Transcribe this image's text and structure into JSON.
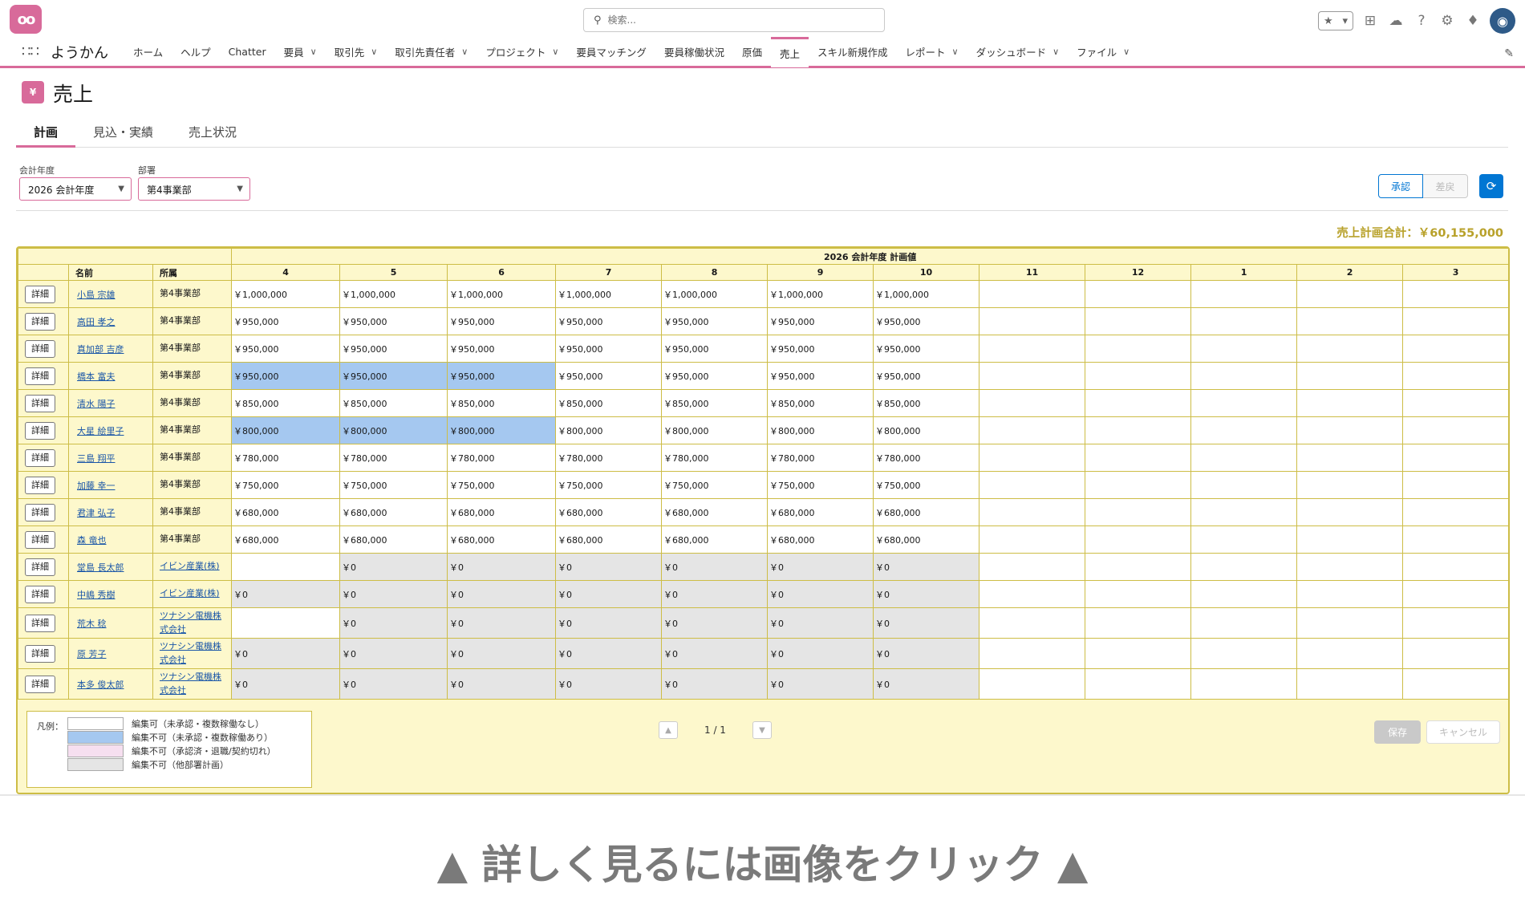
{
  "topbar": {
    "search_placeholder": "検索...",
    "icons": [
      "favorites-star-icon",
      "add-icon",
      "trailhead-icon",
      "help-icon",
      "gear-icon",
      "bell-icon",
      "avatar"
    ]
  },
  "nav": {
    "app_name": "ようかん",
    "items": [
      {
        "label": "ホーム",
        "chevron": false
      },
      {
        "label": "ヘルプ",
        "chevron": false
      },
      {
        "label": "Chatter",
        "chevron": false
      },
      {
        "label": "要員",
        "chevron": true
      },
      {
        "label": "取引先",
        "chevron": true
      },
      {
        "label": "取引先責任者",
        "chevron": true
      },
      {
        "label": "プロジェクト",
        "chevron": true
      },
      {
        "label": "要員マッチング",
        "chevron": false
      },
      {
        "label": "要員稼働状況",
        "chevron": false
      },
      {
        "label": "原価",
        "chevron": false
      },
      {
        "label": "売上",
        "chevron": false,
        "active": true
      },
      {
        "label": "スキル新規作成",
        "chevron": false
      },
      {
        "label": "レポート",
        "chevron": true
      },
      {
        "label": "ダッシュボード",
        "chevron": true
      },
      {
        "label": "ファイル",
        "chevron": true
      }
    ]
  },
  "page": {
    "icon_text": "¥",
    "title": "売上",
    "tabs": [
      "計画",
      "見込・実績",
      "売上状況"
    ]
  },
  "filters": {
    "year_label": "会計年度",
    "year_value": "2026 会計年度",
    "dept_label": "部署",
    "dept_value": "第4事業部"
  },
  "actions": {
    "approve": "承認",
    "revert": "差戻",
    "refresh_icon": "refresh-icon"
  },
  "total_text": "売上計画合計：￥60,155,000",
  "table": {
    "header_title": "2026 会計年度 計画値",
    "col_name": "名前",
    "col_aff": "所属",
    "months": [
      "4",
      "5",
      "6",
      "7",
      "8",
      "9",
      "10",
      "11",
      "12",
      "1",
      "2",
      "3"
    ],
    "detail_label": "詳細",
    "rows": [
      {
        "name": "小島 宗雄",
        "aff": "第4事業部",
        "aff_link": false,
        "tall": false,
        "cells": [
          [
            "w",
            "￥1,000,000"
          ],
          [
            "w",
            "￥1,000,000"
          ],
          [
            "w",
            "￥1,000,000"
          ],
          [
            "w",
            "￥1,000,000"
          ],
          [
            "w",
            "￥1,000,000"
          ],
          [
            "w",
            "￥1,000,000"
          ],
          [
            "w",
            "￥1,000,000"
          ],
          [
            "w",
            ""
          ],
          [
            "w",
            ""
          ],
          [
            "w",
            ""
          ],
          [
            "w",
            ""
          ],
          [
            "w",
            ""
          ]
        ]
      },
      {
        "name": "高田 孝之",
        "aff": "第4事業部",
        "aff_link": false,
        "tall": false,
        "cells": [
          [
            "w",
            "￥950,000"
          ],
          [
            "w",
            "￥950,000"
          ],
          [
            "w",
            "￥950,000"
          ],
          [
            "w",
            "￥950,000"
          ],
          [
            "w",
            "￥950,000"
          ],
          [
            "w",
            "￥950,000"
          ],
          [
            "w",
            "￥950,000"
          ],
          [
            "w",
            ""
          ],
          [
            "w",
            ""
          ],
          [
            "w",
            ""
          ],
          [
            "w",
            ""
          ],
          [
            "w",
            ""
          ]
        ]
      },
      {
        "name": "真加部 吉彦",
        "aff": "第4事業部",
        "aff_link": false,
        "tall": false,
        "cells": [
          [
            "w",
            "￥950,000"
          ],
          [
            "w",
            "￥950,000"
          ],
          [
            "w",
            "￥950,000"
          ],
          [
            "w",
            "￥950,000"
          ],
          [
            "w",
            "￥950,000"
          ],
          [
            "w",
            "￥950,000"
          ],
          [
            "w",
            "￥950,000"
          ],
          [
            "w",
            ""
          ],
          [
            "w",
            ""
          ],
          [
            "w",
            ""
          ],
          [
            "w",
            ""
          ],
          [
            "w",
            ""
          ]
        ]
      },
      {
        "name": "橋本 富夫",
        "aff": "第4事業部",
        "aff_link": false,
        "tall": false,
        "cells": [
          [
            "b",
            "￥950,000"
          ],
          [
            "b",
            "￥950,000"
          ],
          [
            "b",
            "￥950,000"
          ],
          [
            "w",
            "￥950,000"
          ],
          [
            "w",
            "￥950,000"
          ],
          [
            "w",
            "￥950,000"
          ],
          [
            "w",
            "￥950,000"
          ],
          [
            "w",
            ""
          ],
          [
            "w",
            ""
          ],
          [
            "w",
            ""
          ],
          [
            "w",
            ""
          ],
          [
            "w",
            ""
          ]
        ]
      },
      {
        "name": "清水 陽子",
        "aff": "第4事業部",
        "aff_link": false,
        "tall": false,
        "cells": [
          [
            "w",
            "￥850,000"
          ],
          [
            "w",
            "￥850,000"
          ],
          [
            "w",
            "￥850,000"
          ],
          [
            "w",
            "￥850,000"
          ],
          [
            "w",
            "￥850,000"
          ],
          [
            "w",
            "￥850,000"
          ],
          [
            "w",
            "￥850,000"
          ],
          [
            "w",
            ""
          ],
          [
            "w",
            ""
          ],
          [
            "w",
            ""
          ],
          [
            "w",
            ""
          ],
          [
            "w",
            ""
          ]
        ]
      },
      {
        "name": "大星 絵里子",
        "aff": "第4事業部",
        "aff_link": false,
        "tall": false,
        "cells": [
          [
            "b",
            "￥800,000"
          ],
          [
            "b",
            "￥800,000"
          ],
          [
            "b",
            "￥800,000"
          ],
          [
            "w",
            "￥800,000"
          ],
          [
            "w",
            "￥800,000"
          ],
          [
            "w",
            "￥800,000"
          ],
          [
            "w",
            "￥800,000"
          ],
          [
            "w",
            ""
          ],
          [
            "w",
            ""
          ],
          [
            "w",
            ""
          ],
          [
            "w",
            ""
          ],
          [
            "w",
            ""
          ]
        ]
      },
      {
        "name": "三島 翔平",
        "aff": "第4事業部",
        "aff_link": false,
        "tall": false,
        "cells": [
          [
            "w",
            "￥780,000"
          ],
          [
            "w",
            "￥780,000"
          ],
          [
            "w",
            "￥780,000"
          ],
          [
            "w",
            "￥780,000"
          ],
          [
            "w",
            "￥780,000"
          ],
          [
            "w",
            "￥780,000"
          ],
          [
            "w",
            "￥780,000"
          ],
          [
            "w",
            ""
          ],
          [
            "w",
            ""
          ],
          [
            "w",
            ""
          ],
          [
            "w",
            ""
          ],
          [
            "w",
            ""
          ]
        ]
      },
      {
        "name": "加藤 幸一",
        "aff": "第4事業部",
        "aff_link": false,
        "tall": false,
        "cells": [
          [
            "w",
            "￥750,000"
          ],
          [
            "w",
            "￥750,000"
          ],
          [
            "w",
            "￥750,000"
          ],
          [
            "w",
            "￥750,000"
          ],
          [
            "w",
            "￥750,000"
          ],
          [
            "w",
            "￥750,000"
          ],
          [
            "w",
            "￥750,000"
          ],
          [
            "w",
            ""
          ],
          [
            "w",
            ""
          ],
          [
            "w",
            ""
          ],
          [
            "w",
            ""
          ],
          [
            "w",
            ""
          ]
        ]
      },
      {
        "name": "君津 弘子",
        "aff": "第4事業部",
        "aff_link": false,
        "tall": false,
        "cells": [
          [
            "w",
            "￥680,000"
          ],
          [
            "w",
            "￥680,000"
          ],
          [
            "w",
            "￥680,000"
          ],
          [
            "w",
            "￥680,000"
          ],
          [
            "w",
            "￥680,000"
          ],
          [
            "w",
            "￥680,000"
          ],
          [
            "w",
            "￥680,000"
          ],
          [
            "w",
            ""
          ],
          [
            "w",
            ""
          ],
          [
            "w",
            ""
          ],
          [
            "w",
            ""
          ],
          [
            "w",
            ""
          ]
        ]
      },
      {
        "name": "森 竜也",
        "aff": "第4事業部",
        "aff_link": false,
        "tall": false,
        "cells": [
          [
            "w",
            "￥680,000"
          ],
          [
            "w",
            "￥680,000"
          ],
          [
            "w",
            "￥680,000"
          ],
          [
            "w",
            "￥680,000"
          ],
          [
            "w",
            "￥680,000"
          ],
          [
            "w",
            "￥680,000"
          ],
          [
            "w",
            "￥680,000"
          ],
          [
            "w",
            ""
          ],
          [
            "w",
            ""
          ],
          [
            "w",
            ""
          ],
          [
            "w",
            ""
          ],
          [
            "w",
            ""
          ]
        ]
      },
      {
        "name": "堂島 長太郎",
        "aff": "イビン産業(株)",
        "aff_link": true,
        "tall": false,
        "cells": [
          [
            "w",
            ""
          ],
          [
            "g",
            "￥0"
          ],
          [
            "g",
            "￥0"
          ],
          [
            "g",
            "￥0"
          ],
          [
            "g",
            "￥0"
          ],
          [
            "g",
            "￥0"
          ],
          [
            "g",
            "￥0"
          ],
          [
            "w",
            ""
          ],
          [
            "w",
            ""
          ],
          [
            "w",
            ""
          ],
          [
            "w",
            ""
          ],
          [
            "w",
            ""
          ]
        ]
      },
      {
        "name": "中嶋 秀樹",
        "aff": "イビン産業(株)",
        "aff_link": true,
        "tall": false,
        "cells": [
          [
            "g",
            "￥0"
          ],
          [
            "g",
            "￥0"
          ],
          [
            "g",
            "￥0"
          ],
          [
            "g",
            "￥0"
          ],
          [
            "g",
            "￥0"
          ],
          [
            "g",
            "￥0"
          ],
          [
            "g",
            "￥0"
          ],
          [
            "w",
            ""
          ],
          [
            "w",
            ""
          ],
          [
            "w",
            ""
          ],
          [
            "w",
            ""
          ],
          [
            "w",
            ""
          ]
        ]
      },
      {
        "name": "荒木 稔",
        "aff": "ツナシン電機株式会社",
        "aff_link": true,
        "tall": true,
        "cells": [
          [
            "w",
            ""
          ],
          [
            "g",
            "￥0"
          ],
          [
            "g",
            "￥0"
          ],
          [
            "g",
            "￥0"
          ],
          [
            "g",
            "￥0"
          ],
          [
            "g",
            "￥0"
          ],
          [
            "g",
            "￥0"
          ],
          [
            "w",
            ""
          ],
          [
            "w",
            ""
          ],
          [
            "w",
            ""
          ],
          [
            "w",
            ""
          ],
          [
            "w",
            ""
          ]
        ]
      },
      {
        "name": "原 芳子",
        "aff": "ツナシン電機株式会社",
        "aff_link": true,
        "tall": true,
        "cells": [
          [
            "g",
            "￥0"
          ],
          [
            "g",
            "￥0"
          ],
          [
            "g",
            "￥0"
          ],
          [
            "g",
            "￥0"
          ],
          [
            "g",
            "￥0"
          ],
          [
            "g",
            "￥0"
          ],
          [
            "g",
            "￥0"
          ],
          [
            "w",
            ""
          ],
          [
            "w",
            ""
          ],
          [
            "w",
            ""
          ],
          [
            "w",
            ""
          ],
          [
            "w",
            ""
          ]
        ]
      },
      {
        "name": "本多 俊太郎",
        "aff": "ツナシン電機株式会社",
        "aff_link": true,
        "tall": true,
        "cells": [
          [
            "g",
            "￥0"
          ],
          [
            "g",
            "￥0"
          ],
          [
            "g",
            "￥0"
          ],
          [
            "g",
            "￥0"
          ],
          [
            "g",
            "￥0"
          ],
          [
            "g",
            "￥0"
          ],
          [
            "g",
            "￥0"
          ],
          [
            "w",
            ""
          ],
          [
            "w",
            ""
          ],
          [
            "w",
            ""
          ],
          [
            "w",
            ""
          ],
          [
            "w",
            ""
          ]
        ]
      }
    ]
  },
  "legend": {
    "title": "凡例：",
    "items": [
      {
        "color": "#ffffff",
        "label": "編集可（未承認・複数稼働なし）"
      },
      {
        "color": "#a5c8f0",
        "label": "編集不可（未承認・複数稼働あり）"
      },
      {
        "color": "#f6dff0",
        "label": "編集不可（承認済・退職/契約切れ）"
      },
      {
        "color": "#e5e5e5",
        "label": "編集不可（他部署計画）"
      }
    ]
  },
  "pager": {
    "info": "1 / 1",
    "prev": "▲",
    "next": "▼"
  },
  "footer_buttons": {
    "save": "保存",
    "cancel": "キャンセル"
  },
  "caption": "▲ 詳しく見るには画像をクリック ▲"
}
